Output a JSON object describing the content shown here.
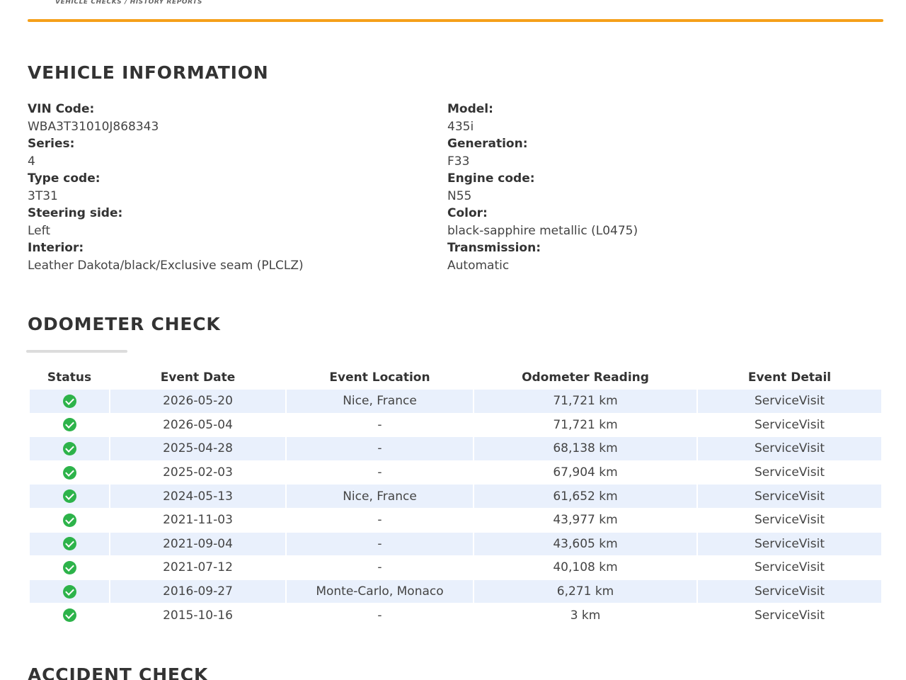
{
  "header": {
    "tagline": "VEHICLE CHECKS / HISTORY REPORTS",
    "accent_color": "#f5a01a"
  },
  "vehicle_information": {
    "title": "VEHICLE INFORMATION",
    "left": [
      {
        "label": "VIN Code:",
        "value": "WBA3T31010J868343"
      },
      {
        "label": "Series:",
        "value": "4"
      },
      {
        "label": "Type code:",
        "value": "3T31"
      },
      {
        "label": "Steering side:",
        "value": "Left"
      },
      {
        "label": "Interior:",
        "value": "Leather Dakota/black/Exclusive seam (PLCLZ)"
      }
    ],
    "right": [
      {
        "label": "Model:",
        "value": "435i"
      },
      {
        "label": "Generation:",
        "value": "F33"
      },
      {
        "label": "Engine code:",
        "value": "N55"
      },
      {
        "label": "Color:",
        "value": "black-sapphire metallic (L0475)"
      },
      {
        "label": "Transmission:",
        "value": "Automatic"
      }
    ]
  },
  "odometer_check": {
    "title": "ODOMETER CHECK",
    "columns": [
      "Status",
      "Event Date",
      "Event Location",
      "Odometer Reading",
      "Event Detail"
    ],
    "status_icon": "check-circle-icon",
    "status_color": "#2db34a",
    "row_shade_color": "#e9f0fc",
    "rows": [
      {
        "date": "2026-05-20",
        "location": "Nice, France",
        "reading": "71,721 km",
        "detail": "ServiceVisit"
      },
      {
        "date": "2026-05-04",
        "location": "-",
        "reading": "71,721 km",
        "detail": "ServiceVisit"
      },
      {
        "date": "2025-04-28",
        "location": "-",
        "reading": "68,138 km",
        "detail": "ServiceVisit"
      },
      {
        "date": "2025-02-03",
        "location": "-",
        "reading": "67,904 km",
        "detail": "ServiceVisit"
      },
      {
        "date": "2024-05-13",
        "location": "Nice, France",
        "reading": "61,652 km",
        "detail": "ServiceVisit"
      },
      {
        "date": "2021-11-03",
        "location": "-",
        "reading": "43,977 km",
        "detail": "ServiceVisit"
      },
      {
        "date": "2021-09-04",
        "location": "-",
        "reading": "43,605 km",
        "detail": "ServiceVisit"
      },
      {
        "date": "2021-07-12",
        "location": "-",
        "reading": "40,108 km",
        "detail": "ServiceVisit"
      },
      {
        "date": "2016-09-27",
        "location": "Monte-Carlo, Monaco",
        "reading": "6,271 km",
        "detail": "ServiceVisit"
      },
      {
        "date": "2015-10-16",
        "location": "-",
        "reading": "3 km",
        "detail": "ServiceVisit"
      }
    ]
  },
  "accident_check": {
    "title": "ACCIDENT CHECK"
  }
}
